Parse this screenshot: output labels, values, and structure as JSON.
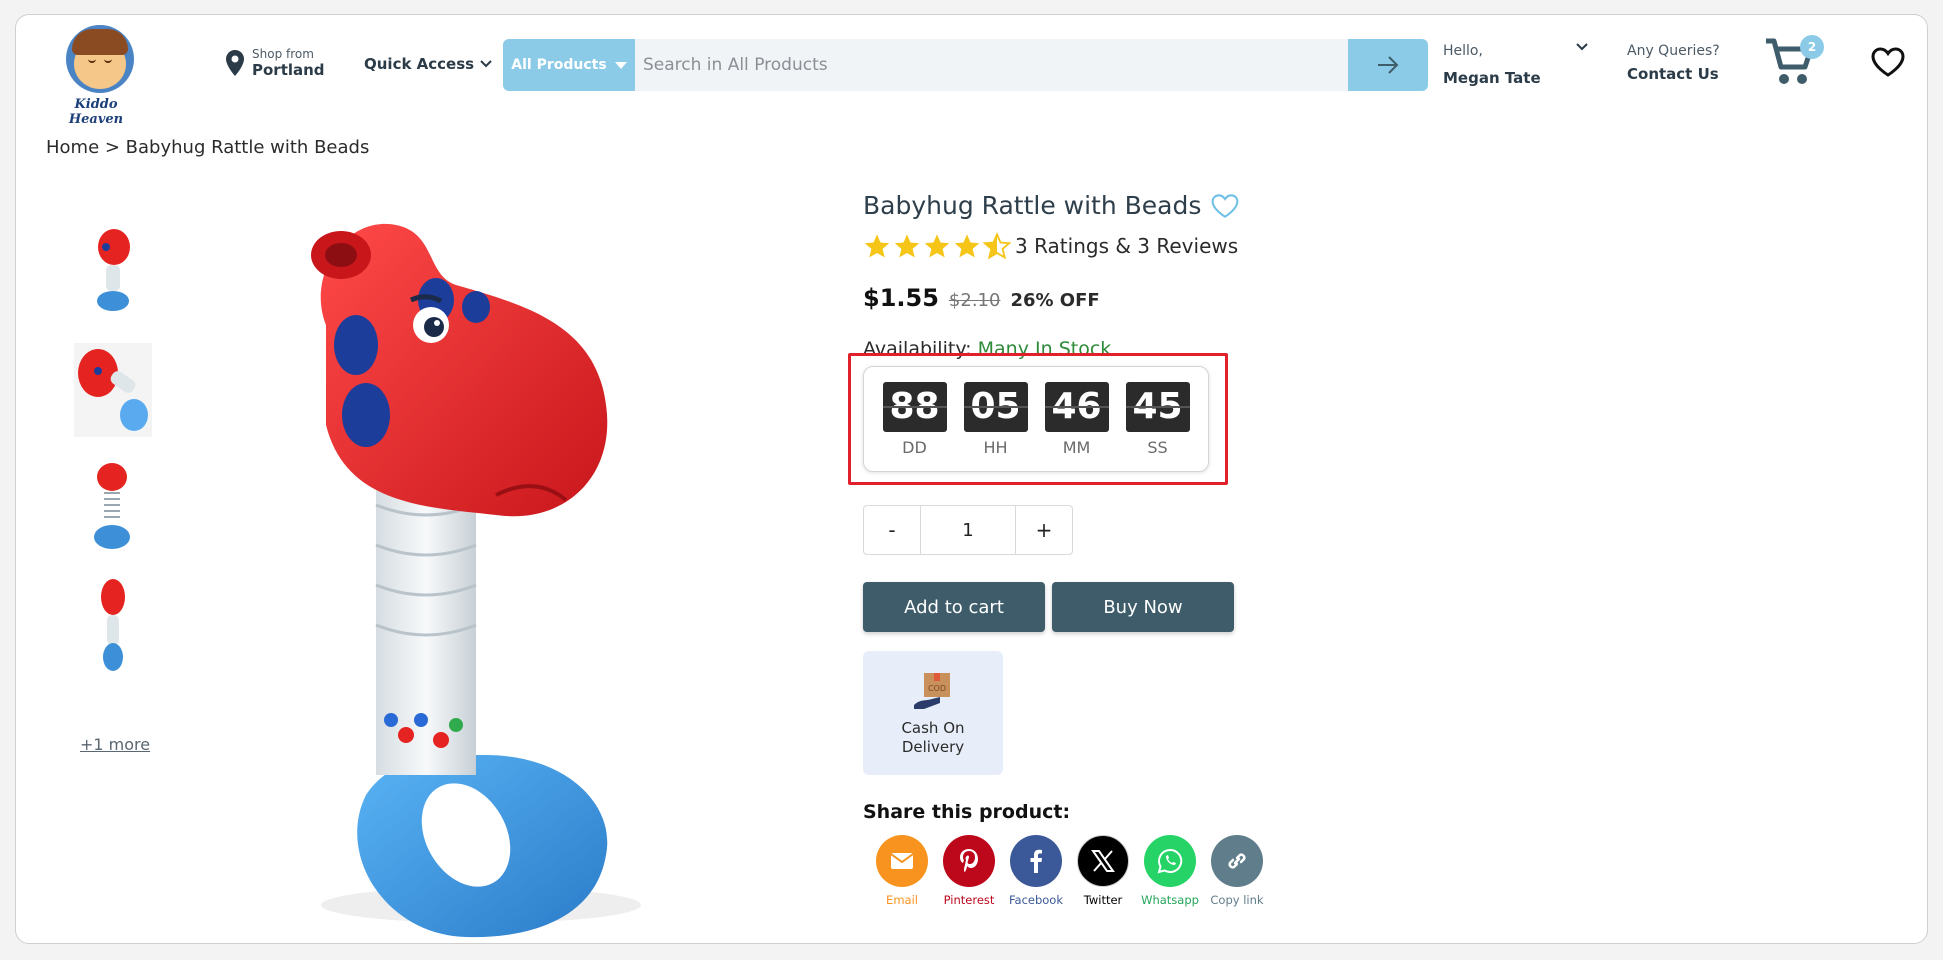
{
  "header": {
    "logo_text": "Kiddo Heaven",
    "location_small": "Shop from",
    "location_city": "Portland",
    "quick_access": "Quick Access",
    "search_category": "All Products",
    "search_placeholder": "Search in All Products",
    "hello": "Hello,",
    "user_name": "Megan Tate",
    "queries": "Any Queries?",
    "contact": "Contact Us",
    "cart_count": "2"
  },
  "breadcrumb": "Home > Babyhug Rattle with Beads",
  "gallery": {
    "more": "+1 more"
  },
  "product": {
    "title": "Babyhug Rattle with Beads",
    "rating_value": 4.5,
    "rating_text": "3 Ratings & 3 Reviews",
    "price": "$1.55",
    "mrp": "$2.10",
    "discount": "26% OFF",
    "availability_label": "Availability:",
    "availability_value": "Many In Stock"
  },
  "timer": {
    "days": "88",
    "days_label": "DD",
    "hours": "05",
    "hours_label": "HH",
    "minutes": "46",
    "minutes_label": "MM",
    "seconds": "45",
    "seconds_label": "SS"
  },
  "quantity": {
    "minus": "-",
    "value": "1",
    "plus": "+"
  },
  "actions": {
    "add_to_cart": "Add to cart",
    "buy_now": "Buy Now"
  },
  "cod": {
    "label": "Cash On Delivery",
    "badge": "COD"
  },
  "share": {
    "title": "Share this product:",
    "items": [
      {
        "label": "Email",
        "color": "#f7931e",
        "icon": "email-icon"
      },
      {
        "label": "Pinterest",
        "color": "#bd081c",
        "icon": "pinterest-icon"
      },
      {
        "label": "Facebook",
        "color": "#3b5998",
        "icon": "facebook-icon"
      },
      {
        "label": "Twitter",
        "color": "#000000",
        "icon": "x-twitter-icon"
      },
      {
        "label": "Whatsapp",
        "color": "#25d366",
        "icon": "whatsapp-icon"
      },
      {
        "label": "Copy link",
        "color": "#5f7d8b",
        "icon": "link-icon"
      }
    ]
  }
}
